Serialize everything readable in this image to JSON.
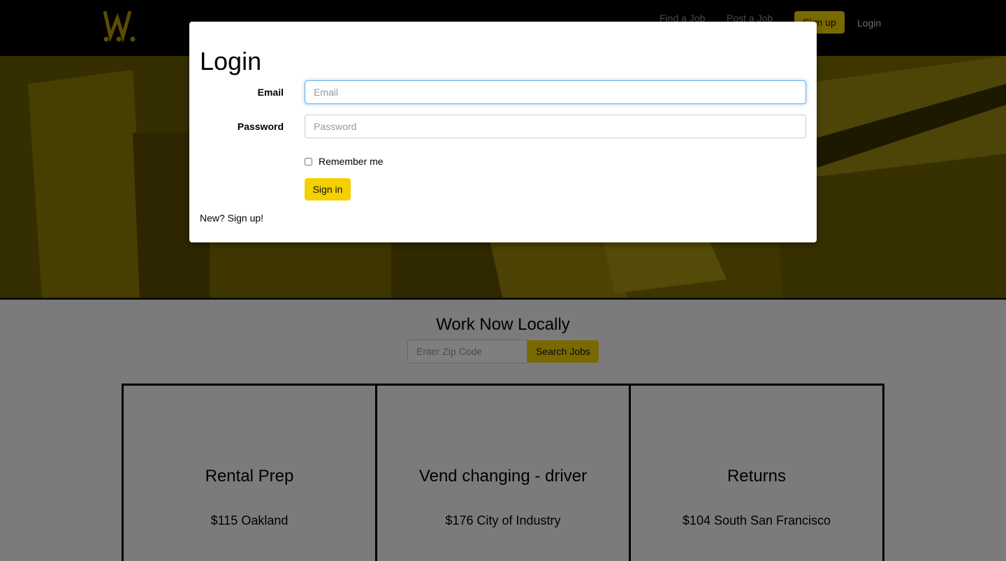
{
  "nav": {
    "find_job": "Find a Job",
    "post_job": "Post a Job",
    "signup": "Sign up",
    "login": "Login",
    "logo_icon": "w-logo-icon"
  },
  "search": {
    "title": "Work Now Locally",
    "zip_placeholder": "Enter Zip Code",
    "button": "Search Jobs"
  },
  "jobs": [
    {
      "title": "Rental Prep",
      "pay_location": "$115 Oakland"
    },
    {
      "title": "Vend changing - driver",
      "pay_location": "$176 City of Industry"
    },
    {
      "title": "Returns",
      "pay_location": "$104 South San Francisco"
    }
  ],
  "login_modal": {
    "title": "Login",
    "email_label": "Email",
    "email_placeholder": "Email",
    "password_label": "Password",
    "password_placeholder": "Password",
    "remember_label": "Remember me",
    "signin_button": "Sign in",
    "signup_link": "New? Sign up!"
  },
  "colors": {
    "accent": "#f5d000",
    "navbar": "#000000",
    "hero_tint": "#8a7800"
  }
}
